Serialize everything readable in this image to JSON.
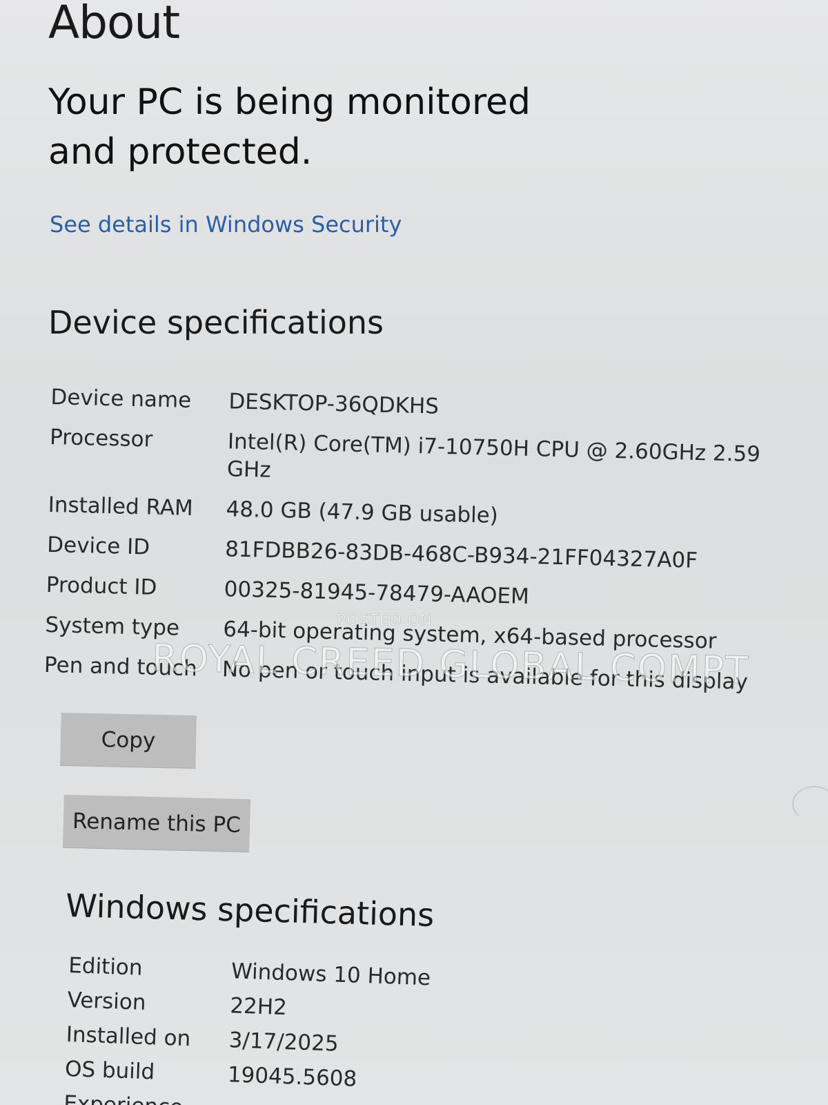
{
  "page": {
    "title": "About",
    "protection_status": "Your PC is being monitored and protected.",
    "security_link": "See details in Windows Security"
  },
  "device_specs": {
    "heading": "Device specifications",
    "rows": [
      {
        "label": "Device name",
        "value": "DESKTOP-36QDKHS"
      },
      {
        "label": "Processor",
        "value": "Intel(R) Core(TM) i7-10750H CPU @ 2.60GHz   2.59 GHz"
      },
      {
        "label": "Installed RAM",
        "value": "48.0 GB (47.9 GB usable)"
      },
      {
        "label": "Device ID",
        "value": "81FDBB26-83DB-468C-B934-21FF04327A0F"
      },
      {
        "label": "Product ID",
        "value": "00325-81945-78479-AAOEM"
      },
      {
        "label": "System type",
        "value": "64-bit operating system, x64-based processor"
      },
      {
        "label": "Pen and touch",
        "value": "No pen or touch input is available for this display"
      }
    ],
    "copy_button": "Copy",
    "rename_button": "Rename this PC"
  },
  "windows_specs": {
    "heading": "Windows specifications",
    "rows": [
      {
        "label": "Edition",
        "value": "Windows 10 Home"
      },
      {
        "label": "Version",
        "value": "22H2"
      },
      {
        "label": "Installed on",
        "value": "3/17/2025"
      },
      {
        "label": "OS build",
        "value": "19045.5608"
      },
      {
        "label": "Experience",
        "value": ""
      }
    ]
  },
  "watermark": {
    "main": "ROYAL CREED GLOBAL COMPT",
    "small": "POSTED ON"
  }
}
